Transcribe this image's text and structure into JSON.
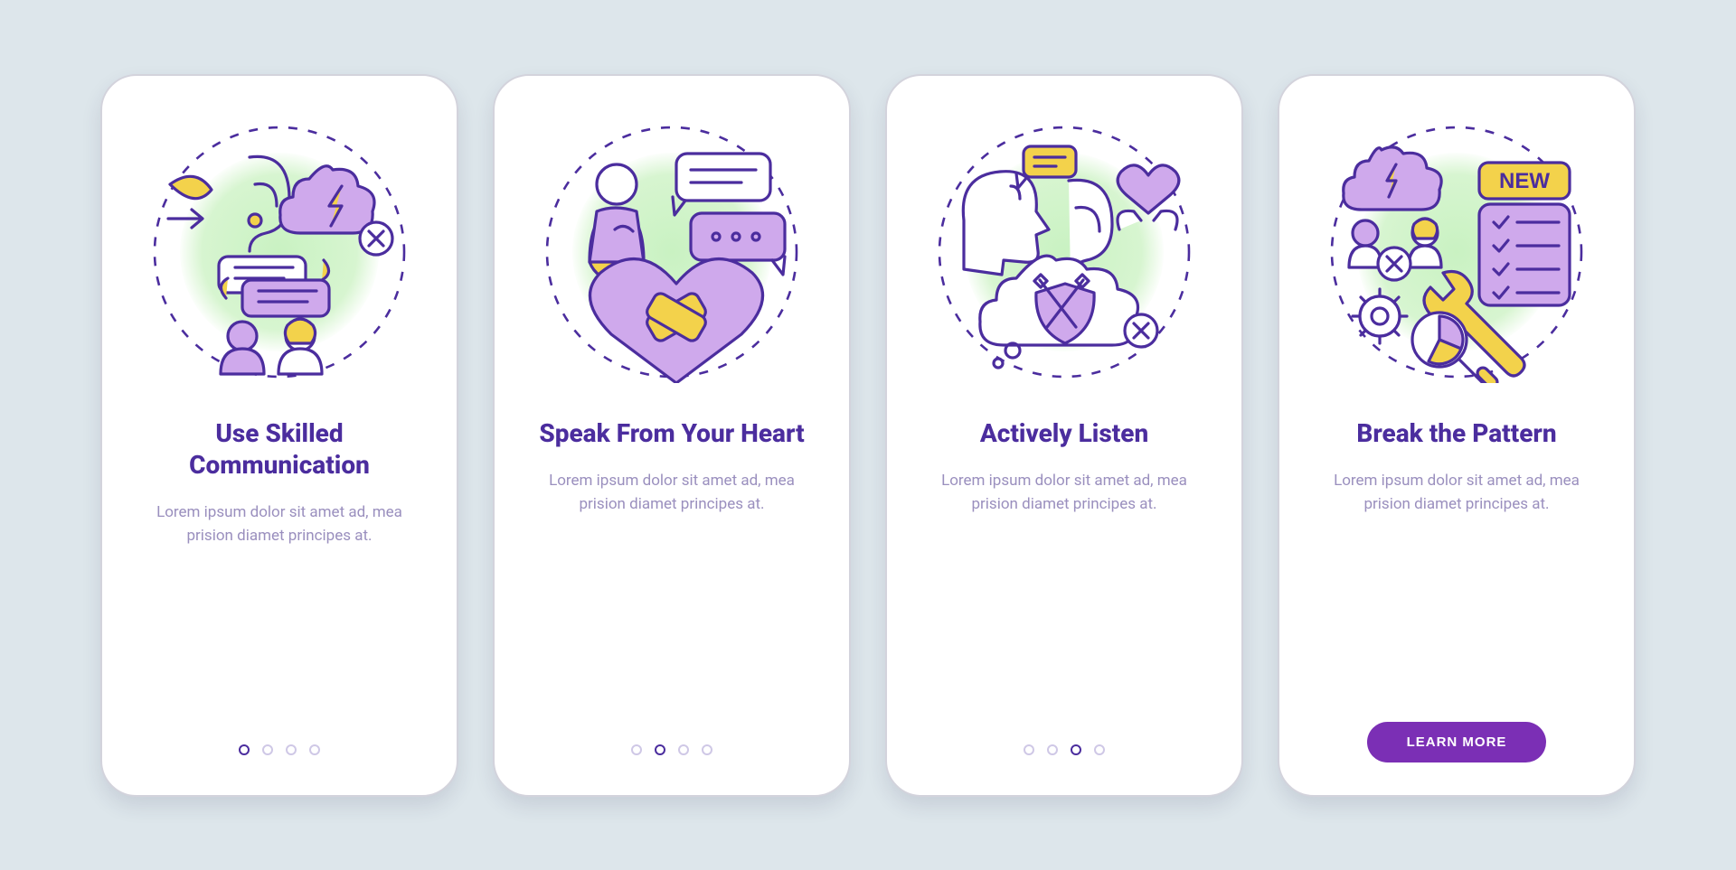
{
  "colors": {
    "primary_purple": "#4b2d9e",
    "cta_purple": "#7b2fb5",
    "accent_yellow": "#f3d24b",
    "accent_lavender": "#cfa9ec",
    "soft_green": "#c9f2c2",
    "desc_text": "#9a8fbe"
  },
  "screens": [
    {
      "id": "use-skilled-communication",
      "title": "Use Skilled Communication",
      "description": "Lorem ipsum dolor sit amet ad, mea prision diamet principes at.",
      "active_dot_index": 0,
      "icons": [
        "leaf-arrow-icon",
        "ear-icon",
        "storm-thought-bubble-icon",
        "x-circle-icon",
        "speech-exchange-icon",
        "two-people-icon"
      ]
    },
    {
      "id": "speak-from-your-heart",
      "title": "Speak From Your Heart",
      "description": "Lorem ipsum dolor sit amet ad, mea prision diamet principes at.",
      "active_dot_index": 1,
      "icons": [
        "person-hand-on-chest-icon",
        "chat-dialog-lines-icon",
        "chat-dialog-dots-icon",
        "bandaged-heart-icon"
      ]
    },
    {
      "id": "actively-listen",
      "title": "Actively Listen",
      "description": "Lorem ipsum dolor sit amet ad, mea prision diamet principes at.",
      "active_dot_index": 2,
      "icons": [
        "talking-head-icon",
        "speech-bubble-icon",
        "ear-icon",
        "caring-hands-heart-icon",
        "crossed-swords-shield-thought-icon",
        "x-circle-icon"
      ]
    },
    {
      "id": "break-the-pattern",
      "title": "Break the Pattern",
      "description": "Lorem ipsum dolor sit amet ad, mea prision diamet principes at.",
      "cta_label": "LEARN MORE",
      "icons": [
        "argument-people-storm-icon",
        "x-circle-icon",
        "new-badge-icon",
        "checklist-board-icon",
        "gear-icon",
        "wrench-icon",
        "magnifier-pie-icon"
      ]
    }
  ]
}
